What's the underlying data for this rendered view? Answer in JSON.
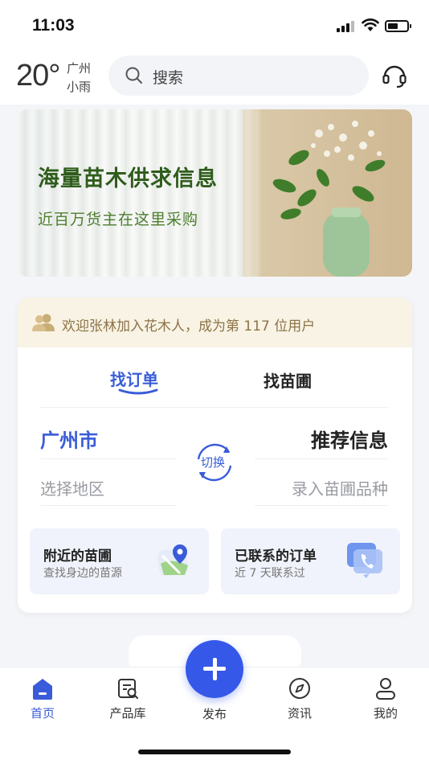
{
  "status_bar": {
    "time": "11:03"
  },
  "header": {
    "temperature": "20°",
    "city": "广州",
    "weather": "小雨",
    "search_placeholder": "搜索",
    "icons": {
      "search": "search-icon",
      "support": "headset-icon"
    }
  },
  "banner": {
    "title": "海量苗木供求信息",
    "subtitle": "近百万货主在这里采购"
  },
  "card": {
    "welcome": "欢迎张林加入花木人，成为第 117 位用户",
    "tabs": [
      "找订单",
      "找苗圃"
    ],
    "active_tab": "找订单",
    "left": {
      "value": "广州市",
      "hint": "选择地区"
    },
    "right": {
      "value": "推荐信息",
      "hint": "录入苗圃品种"
    },
    "switch_label": "切换",
    "shortcuts": [
      {
        "title": "附近的苗圃",
        "subtitle": "查找身边的苗源",
        "icon": "map-pin-icon"
      },
      {
        "title": "已联系的订单",
        "subtitle": "近 7 天联系过",
        "icon": "phone-chat-icon"
      }
    ]
  },
  "bottom_nav": {
    "items": [
      {
        "label": "首页",
        "icon": "home-icon",
        "active": true
      },
      {
        "label": "产品库",
        "icon": "catalog-search-icon",
        "active": false
      },
      {
        "label": "发布",
        "icon": "plus-icon",
        "active": false
      },
      {
        "label": "资讯",
        "icon": "compass-icon",
        "active": false
      },
      {
        "label": "我的",
        "icon": "user-icon",
        "active": false
      }
    ]
  },
  "colors": {
    "accent": "#3558e8",
    "banner_title": "#2f5d1c",
    "welcome_bg": "#f8f3e4",
    "welcome_text": "#8d7348"
  }
}
